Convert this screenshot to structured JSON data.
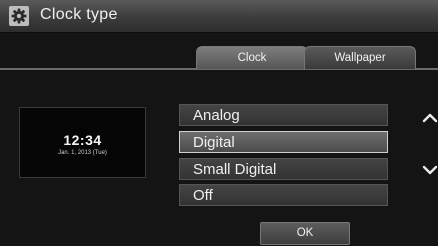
{
  "header": {
    "title": "Clock type",
    "icon": "gear-icon"
  },
  "tabs": [
    {
      "label": "Clock",
      "active": true
    },
    {
      "label": "Wallpaper",
      "active": false
    }
  ],
  "preview": {
    "time": "12:34",
    "date": "Jan. 1, 2013 (Tue)"
  },
  "options": [
    {
      "label": "Analog",
      "selected": false
    },
    {
      "label": "Digital",
      "selected": true
    },
    {
      "label": "Small Digital",
      "selected": false
    },
    {
      "label": "Off",
      "selected": false
    }
  ],
  "ok_label": "OK",
  "scroll": {
    "up_icon": "chevron-up-icon",
    "down_icon": "chevron-down-icon"
  }
}
